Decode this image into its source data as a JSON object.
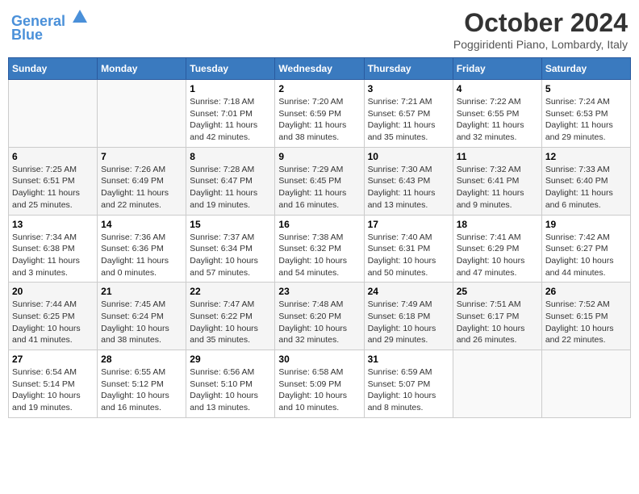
{
  "header": {
    "logo_line1": "General",
    "logo_line2": "Blue",
    "month": "October 2024",
    "location": "Poggiridenti Piano, Lombardy, Italy"
  },
  "weekdays": [
    "Sunday",
    "Monday",
    "Tuesday",
    "Wednesday",
    "Thursday",
    "Friday",
    "Saturday"
  ],
  "weeks": [
    [
      {
        "day": "",
        "info": ""
      },
      {
        "day": "",
        "info": ""
      },
      {
        "day": "1",
        "info": "Sunrise: 7:18 AM\nSunset: 7:01 PM\nDaylight: 11 hours and 42 minutes."
      },
      {
        "day": "2",
        "info": "Sunrise: 7:20 AM\nSunset: 6:59 PM\nDaylight: 11 hours and 38 minutes."
      },
      {
        "day": "3",
        "info": "Sunrise: 7:21 AM\nSunset: 6:57 PM\nDaylight: 11 hours and 35 minutes."
      },
      {
        "day": "4",
        "info": "Sunrise: 7:22 AM\nSunset: 6:55 PM\nDaylight: 11 hours and 32 minutes."
      },
      {
        "day": "5",
        "info": "Sunrise: 7:24 AM\nSunset: 6:53 PM\nDaylight: 11 hours and 29 minutes."
      }
    ],
    [
      {
        "day": "6",
        "info": "Sunrise: 7:25 AM\nSunset: 6:51 PM\nDaylight: 11 hours and 25 minutes."
      },
      {
        "day": "7",
        "info": "Sunrise: 7:26 AM\nSunset: 6:49 PM\nDaylight: 11 hours and 22 minutes."
      },
      {
        "day": "8",
        "info": "Sunrise: 7:28 AM\nSunset: 6:47 PM\nDaylight: 11 hours and 19 minutes."
      },
      {
        "day": "9",
        "info": "Sunrise: 7:29 AM\nSunset: 6:45 PM\nDaylight: 11 hours and 16 minutes."
      },
      {
        "day": "10",
        "info": "Sunrise: 7:30 AM\nSunset: 6:43 PM\nDaylight: 11 hours and 13 minutes."
      },
      {
        "day": "11",
        "info": "Sunrise: 7:32 AM\nSunset: 6:41 PM\nDaylight: 11 hours and 9 minutes."
      },
      {
        "day": "12",
        "info": "Sunrise: 7:33 AM\nSunset: 6:40 PM\nDaylight: 11 hours and 6 minutes."
      }
    ],
    [
      {
        "day": "13",
        "info": "Sunrise: 7:34 AM\nSunset: 6:38 PM\nDaylight: 11 hours and 3 minutes."
      },
      {
        "day": "14",
        "info": "Sunrise: 7:36 AM\nSunset: 6:36 PM\nDaylight: 11 hours and 0 minutes."
      },
      {
        "day": "15",
        "info": "Sunrise: 7:37 AM\nSunset: 6:34 PM\nDaylight: 10 hours and 57 minutes."
      },
      {
        "day": "16",
        "info": "Sunrise: 7:38 AM\nSunset: 6:32 PM\nDaylight: 10 hours and 54 minutes."
      },
      {
        "day": "17",
        "info": "Sunrise: 7:40 AM\nSunset: 6:31 PM\nDaylight: 10 hours and 50 minutes."
      },
      {
        "day": "18",
        "info": "Sunrise: 7:41 AM\nSunset: 6:29 PM\nDaylight: 10 hours and 47 minutes."
      },
      {
        "day": "19",
        "info": "Sunrise: 7:42 AM\nSunset: 6:27 PM\nDaylight: 10 hours and 44 minutes."
      }
    ],
    [
      {
        "day": "20",
        "info": "Sunrise: 7:44 AM\nSunset: 6:25 PM\nDaylight: 10 hours and 41 minutes."
      },
      {
        "day": "21",
        "info": "Sunrise: 7:45 AM\nSunset: 6:24 PM\nDaylight: 10 hours and 38 minutes."
      },
      {
        "day": "22",
        "info": "Sunrise: 7:47 AM\nSunset: 6:22 PM\nDaylight: 10 hours and 35 minutes."
      },
      {
        "day": "23",
        "info": "Sunrise: 7:48 AM\nSunset: 6:20 PM\nDaylight: 10 hours and 32 minutes."
      },
      {
        "day": "24",
        "info": "Sunrise: 7:49 AM\nSunset: 6:18 PM\nDaylight: 10 hours and 29 minutes."
      },
      {
        "day": "25",
        "info": "Sunrise: 7:51 AM\nSunset: 6:17 PM\nDaylight: 10 hours and 26 minutes."
      },
      {
        "day": "26",
        "info": "Sunrise: 7:52 AM\nSunset: 6:15 PM\nDaylight: 10 hours and 22 minutes."
      }
    ],
    [
      {
        "day": "27",
        "info": "Sunrise: 6:54 AM\nSunset: 5:14 PM\nDaylight: 10 hours and 19 minutes."
      },
      {
        "day": "28",
        "info": "Sunrise: 6:55 AM\nSunset: 5:12 PM\nDaylight: 10 hours and 16 minutes."
      },
      {
        "day": "29",
        "info": "Sunrise: 6:56 AM\nSunset: 5:10 PM\nDaylight: 10 hours and 13 minutes."
      },
      {
        "day": "30",
        "info": "Sunrise: 6:58 AM\nSunset: 5:09 PM\nDaylight: 10 hours and 10 minutes."
      },
      {
        "day": "31",
        "info": "Sunrise: 6:59 AM\nSunset: 5:07 PM\nDaylight: 10 hours and 8 minutes."
      },
      {
        "day": "",
        "info": ""
      },
      {
        "day": "",
        "info": ""
      }
    ]
  ]
}
